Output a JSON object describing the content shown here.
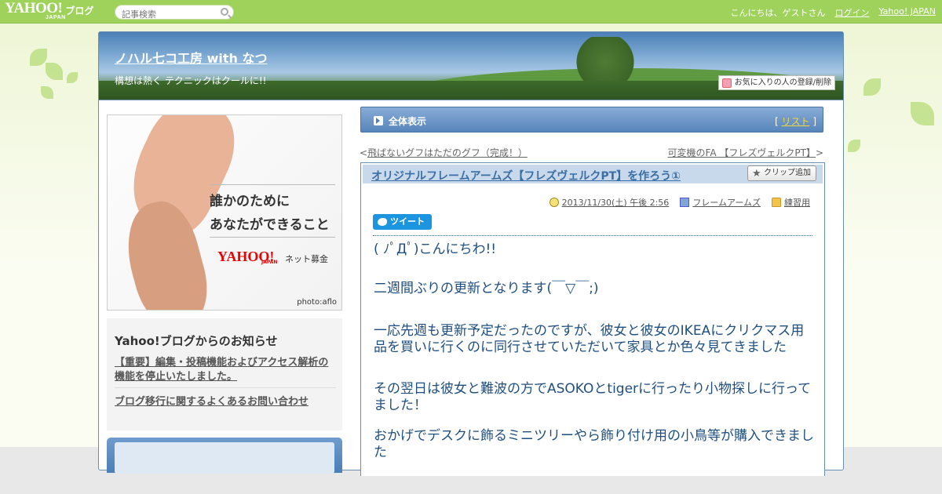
{
  "topbar": {
    "logo_text": "YAHOO!",
    "logo_sub": "JAPAN",
    "logo_blog": "ブログ",
    "search_placeholder": "記事検索",
    "greeting": "こんにちは、ゲストさん",
    "login": "ログイン",
    "yahoo_japan": "Yahoo! JAPAN"
  },
  "header": {
    "blog_title": "ノハル七コ工房 with なつ",
    "blog_desc": "構想は熱く テクニックはクールに!!",
    "fav_button": "お気に入りの人の登録/削除"
  },
  "ad": {
    "line1": "誰かのために",
    "line2": "あなたができること",
    "logo": "YAHOO!",
    "logo_sub": "JAPAN",
    "net": "ネット募金",
    "credit": "photo:aflo"
  },
  "notice": {
    "heading": "Yahoo!ブログからのお知らせ",
    "item1": "【重要】編集・投稿機能およびアクセス解析の機能を停止いたしました。",
    "item2": "ブログ移行に関するよくあるお問い合わせ"
  },
  "all_bar": {
    "label": "全体表示",
    "list_open": "[",
    "list_link": "リスト",
    "list_close": "]"
  },
  "nav": {
    "prev_prefix": "<",
    "prev": "飛ばないグフはただのグフ（完成！）",
    "next": "可変機のFA 【フレズヴェルクPT】",
    "next_suffix": ">"
  },
  "entry": {
    "title": "オリジナルフレームアームズ【フレズヴェルクPT】を作ろう①",
    "clip": "クリップ追加",
    "date": "2013/11/30(土) 午後 2:56",
    "category": "フレームアームズ",
    "folder": "練習用",
    "tweet": "ツイート",
    "p1": "( ﾉﾟДﾟ)こんにちわ!!",
    "p2": "二週間ぶりの更新となります(￣▽￣;)",
    "p3": "一応先週も更新予定だったのですが、彼女と彼女のIKEAにクリクマス用品を買いに行くのに同行させていただいて家具とか色々見てきました",
    "p4": "その翌日は彼女と難波の方でASOKOとtigerに行ったり小物探しに行ってました！",
    "p5": "おかげでデスクに飾るミニツリーやら飾り付け用の小鳥等が購入できました"
  },
  "colors": {
    "topbar": "#9ed25a",
    "header_blue": "#4b7fb6",
    "entry_text": "#1f4e80",
    "link_title": "#3a6ea5"
  }
}
